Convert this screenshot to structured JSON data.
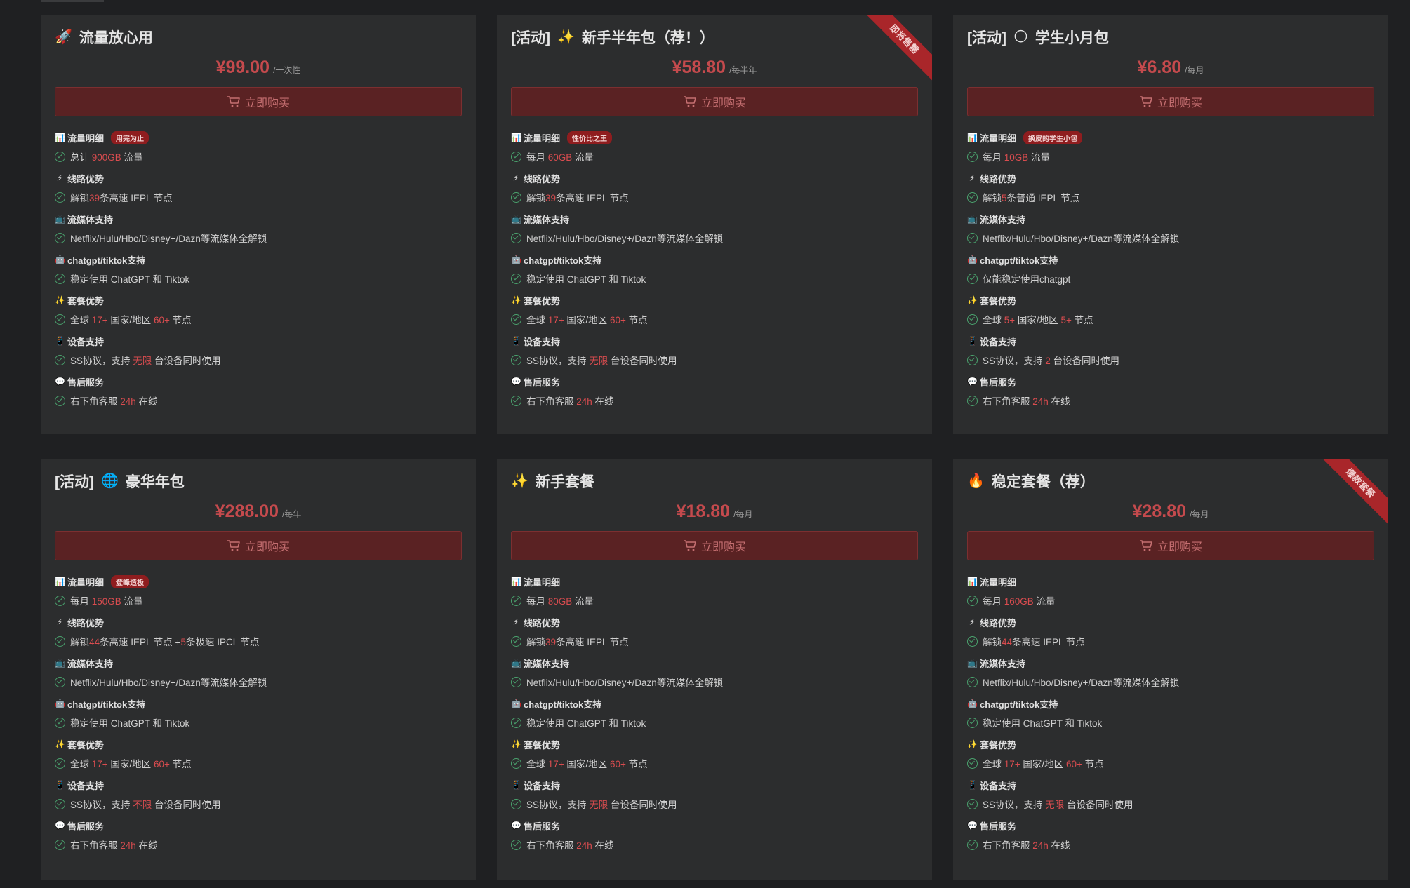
{
  "buy_label": "立即购买",
  "colors": {
    "accent": "#c44a4d",
    "badge": "#8f1d1f",
    "check": "#4aa36e",
    "card_bg": "#2c2d2e"
  },
  "section_titles": {
    "traffic": "流量明细",
    "line": "线路优势",
    "stream": "流媒体支持",
    "ai": "chatgpt/tiktok支持",
    "plan": "套餐优势",
    "device": "设备支持",
    "service": "售后服务"
  },
  "cards": [
    {
      "tag": "",
      "emoji": "🚀",
      "title": "流量放心用",
      "price": "¥99.00",
      "period": "/一次性",
      "ribbon": "",
      "badge": "用完为止",
      "traffic": {
        "pre": "总计 ",
        "hl": "900GB",
        "post": " 流量"
      },
      "line": {
        "pre": "解锁",
        "hl": "39",
        "post": "条高速 IEPL 节点",
        "hl2": "",
        "post2": ""
      },
      "stream": "Netflix/Hulu/Hbo/Disney+/Dazn等流媒体全解锁",
      "ai": "稳定使用 ChatGPT 和 Tiktok",
      "plan": {
        "pre": "全球 ",
        "hl": "17+",
        "mid": " 国家/地区 ",
        "hl2": "60+",
        "post": " 节点"
      },
      "device": {
        "pre": "SS协议，支持 ",
        "hl": "无限",
        "post": " 台设备同时使用"
      },
      "service": {
        "pre": "右下角客服 ",
        "hl": "24h",
        "post": " 在线"
      }
    },
    {
      "tag": "[活动]",
      "emoji": "✨",
      "title": "新手半年包（荐！）",
      "price": "¥58.80",
      "period": "/每半年",
      "ribbon": "即将售罄",
      "badge": "性价比之王",
      "traffic": {
        "pre": "每月 ",
        "hl": "60GB",
        "post": " 流量"
      },
      "line": {
        "pre": "解锁",
        "hl": "39",
        "post": "条高速 IEPL 节点",
        "hl2": "",
        "post2": ""
      },
      "stream": "Netflix/Hulu/Hbo/Disney+/Dazn等流媒体全解锁",
      "ai": "稳定使用 ChatGPT 和 Tiktok",
      "plan": {
        "pre": "全球 ",
        "hl": "17+",
        "mid": " 国家/地区 ",
        "hl2": "60+",
        "post": " 节点"
      },
      "device": {
        "pre": "SS协议，支持 ",
        "hl": "无限",
        "post": " 台设备同时使用"
      },
      "service": {
        "pre": "右下角客服 ",
        "hl": "24h",
        "post": " 在线"
      }
    },
    {
      "tag": "[活动]",
      "emoji": "🌕",
      "title": "学生小月包",
      "price": "¥6.80",
      "period": "/每月",
      "ribbon": "",
      "badge": "换皮的学生小包",
      "traffic": {
        "pre": "每月 ",
        "hl": "10GB",
        "post": " 流量"
      },
      "line": {
        "pre": "解锁",
        "hl": "5",
        "post": "条普通 IEPL 节点",
        "hl2": "",
        "post2": ""
      },
      "stream": "Netflix/Hulu/Hbo/Disney+/Dazn等流媒体全解锁",
      "ai": "仅能稳定使用chatgpt",
      "plan": {
        "pre": "全球 ",
        "hl": "5+",
        "mid": " 国家/地区 ",
        "hl2": "5+",
        "post": " 节点"
      },
      "device": {
        "pre": "SS协议，支持 ",
        "hl": "2",
        "post": " 台设备同时使用"
      },
      "service": {
        "pre": "右下角客服 ",
        "hl": "24h",
        "post": " 在线"
      }
    },
    {
      "tag": "[活动]",
      "emoji": "🌐",
      "title": "豪华年包",
      "price": "¥288.00",
      "period": "/每年",
      "ribbon": "",
      "badge": "登峰造极",
      "traffic": {
        "pre": "每月 ",
        "hl": "150GB",
        "post": " 流量"
      },
      "line": {
        "pre": "解锁",
        "hl": "44",
        "post": "条高速 IEPL 节点 +",
        "hl2": "5",
        "post2": "条极速 IPCL 节点"
      },
      "stream": "Netflix/Hulu/Hbo/Disney+/Dazn等流媒体全解锁",
      "ai": "稳定使用 ChatGPT 和 Tiktok",
      "plan": {
        "pre": "全球 ",
        "hl": "17+",
        "mid": " 国家/地区 ",
        "hl2": "60+",
        "post": " 节点"
      },
      "device": {
        "pre": "SS协议，支持 ",
        "hl": "不限",
        "post": " 台设备同时使用"
      },
      "service": {
        "pre": "右下角客服 ",
        "hl": "24h",
        "post": " 在线"
      }
    },
    {
      "tag": "",
      "emoji": "✨",
      "title": "新手套餐",
      "price": "¥18.80",
      "period": "/每月",
      "ribbon": "",
      "badge": "",
      "traffic": {
        "pre": "每月 ",
        "hl": "80GB",
        "post": " 流量"
      },
      "line": {
        "pre": "解锁",
        "hl": "39",
        "post": "条高速 IEPL 节点",
        "hl2": "",
        "post2": ""
      },
      "stream": "Netflix/Hulu/Hbo/Disney+/Dazn等流媒体全解锁",
      "ai": "稳定使用 ChatGPT 和 Tiktok",
      "plan": {
        "pre": "全球 ",
        "hl": "17+",
        "mid": " 国家/地区 ",
        "hl2": "60+",
        "post": " 节点"
      },
      "device": {
        "pre": "SS协议，支持 ",
        "hl": "无限",
        "post": " 台设备同时使用"
      },
      "service": {
        "pre": "右下角客服 ",
        "hl": "24h",
        "post": " 在线"
      }
    },
    {
      "tag": "",
      "emoji": "🔥",
      "title": "稳定套餐（荐）",
      "price": "¥28.80",
      "period": "/每月",
      "ribbon": "爆款套餐",
      "badge": "",
      "traffic": {
        "pre": "每月 ",
        "hl": "160GB",
        "post": " 流量"
      },
      "line": {
        "pre": "解锁",
        "hl": "44",
        "post": "条高速 IEPL 节点",
        "hl2": "",
        "post2": ""
      },
      "stream": "Netflix/Hulu/Hbo/Disney+/Dazn等流媒体全解锁",
      "ai": "稳定使用 ChatGPT 和 Tiktok",
      "plan": {
        "pre": "全球 ",
        "hl": "17+",
        "mid": " 国家/地区 ",
        "hl2": "60+",
        "post": " 节点"
      },
      "device": {
        "pre": "SS协议，支持 ",
        "hl": "无限",
        "post": " 台设备同时使用"
      },
      "service": {
        "pre": "右下角客服 ",
        "hl": "24h",
        "post": " 在线"
      }
    }
  ]
}
